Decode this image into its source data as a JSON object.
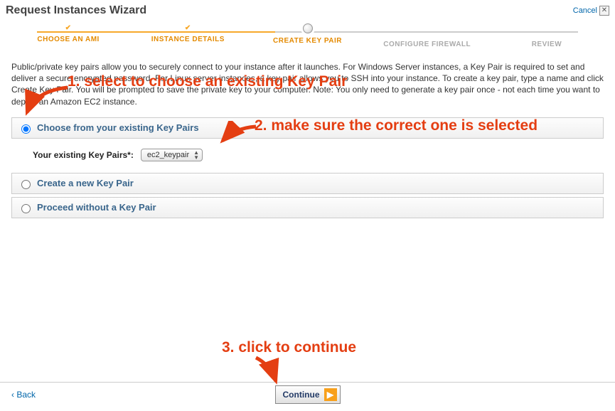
{
  "header": {
    "title": "Request Instances Wizard",
    "cancel": "Cancel"
  },
  "steps": {
    "items": [
      {
        "label": "CHOOSE AN AMI"
      },
      {
        "label": "INSTANCE DETAILS"
      },
      {
        "label": "CREATE KEY PAIR"
      },
      {
        "label": "CONFIGURE FIREWALL"
      },
      {
        "label": "REVIEW"
      }
    ]
  },
  "intro": "Public/private key pairs allow you to securely connect to your instance after it launches. For Windows Server instances, a Key Pair is required to set and deliver a secure encrypted password. For Linux server instances, a key pair allows you to SSH into your instance. To create a key pair, type a name and click Create Key Pair. You will be prompted to save the private key to your computer. Note: You only need to generate a key pair once - not each time you want to deploy an Amazon EC2 instance.",
  "options": {
    "existing": {
      "label": "Choose from your existing Key Pairs",
      "field_label": "Your existing Key Pairs*:",
      "selected": "ec2_keypair"
    },
    "create": {
      "label": "Create a new Key Pair"
    },
    "proceed": {
      "label": "Proceed without a Key Pair"
    }
  },
  "footer": {
    "back": "Back",
    "continue": "Continue"
  },
  "annotations": {
    "a1": "1. select to choose an existing Key Pair",
    "a2": "2. make sure the correct one is selected",
    "a3": "3. click to continue"
  }
}
